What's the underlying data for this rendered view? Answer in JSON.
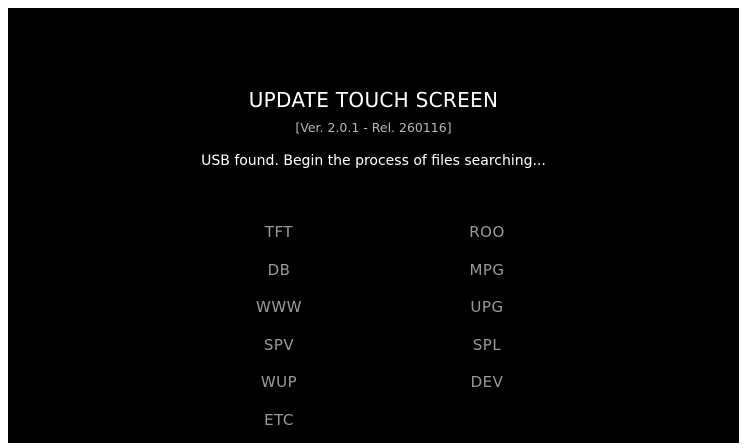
{
  "title": "UPDATE TOUCH SCREEN",
  "version": "[Ver. 2.0.1 - Rel. 260116]",
  "status": "USB found. Begin the process of files searching...",
  "files": {
    "left": [
      "TFT",
      "DB",
      "WWW",
      "SPV",
      "WUP",
      "ETC"
    ],
    "right": [
      "ROO",
      "MPG",
      "UPG",
      "SPL",
      "DEV"
    ]
  },
  "colors": {
    "background": "#000000",
    "title": "#ffffff",
    "version": "#b8b8b8",
    "file_item": "#9a9a9a"
  }
}
